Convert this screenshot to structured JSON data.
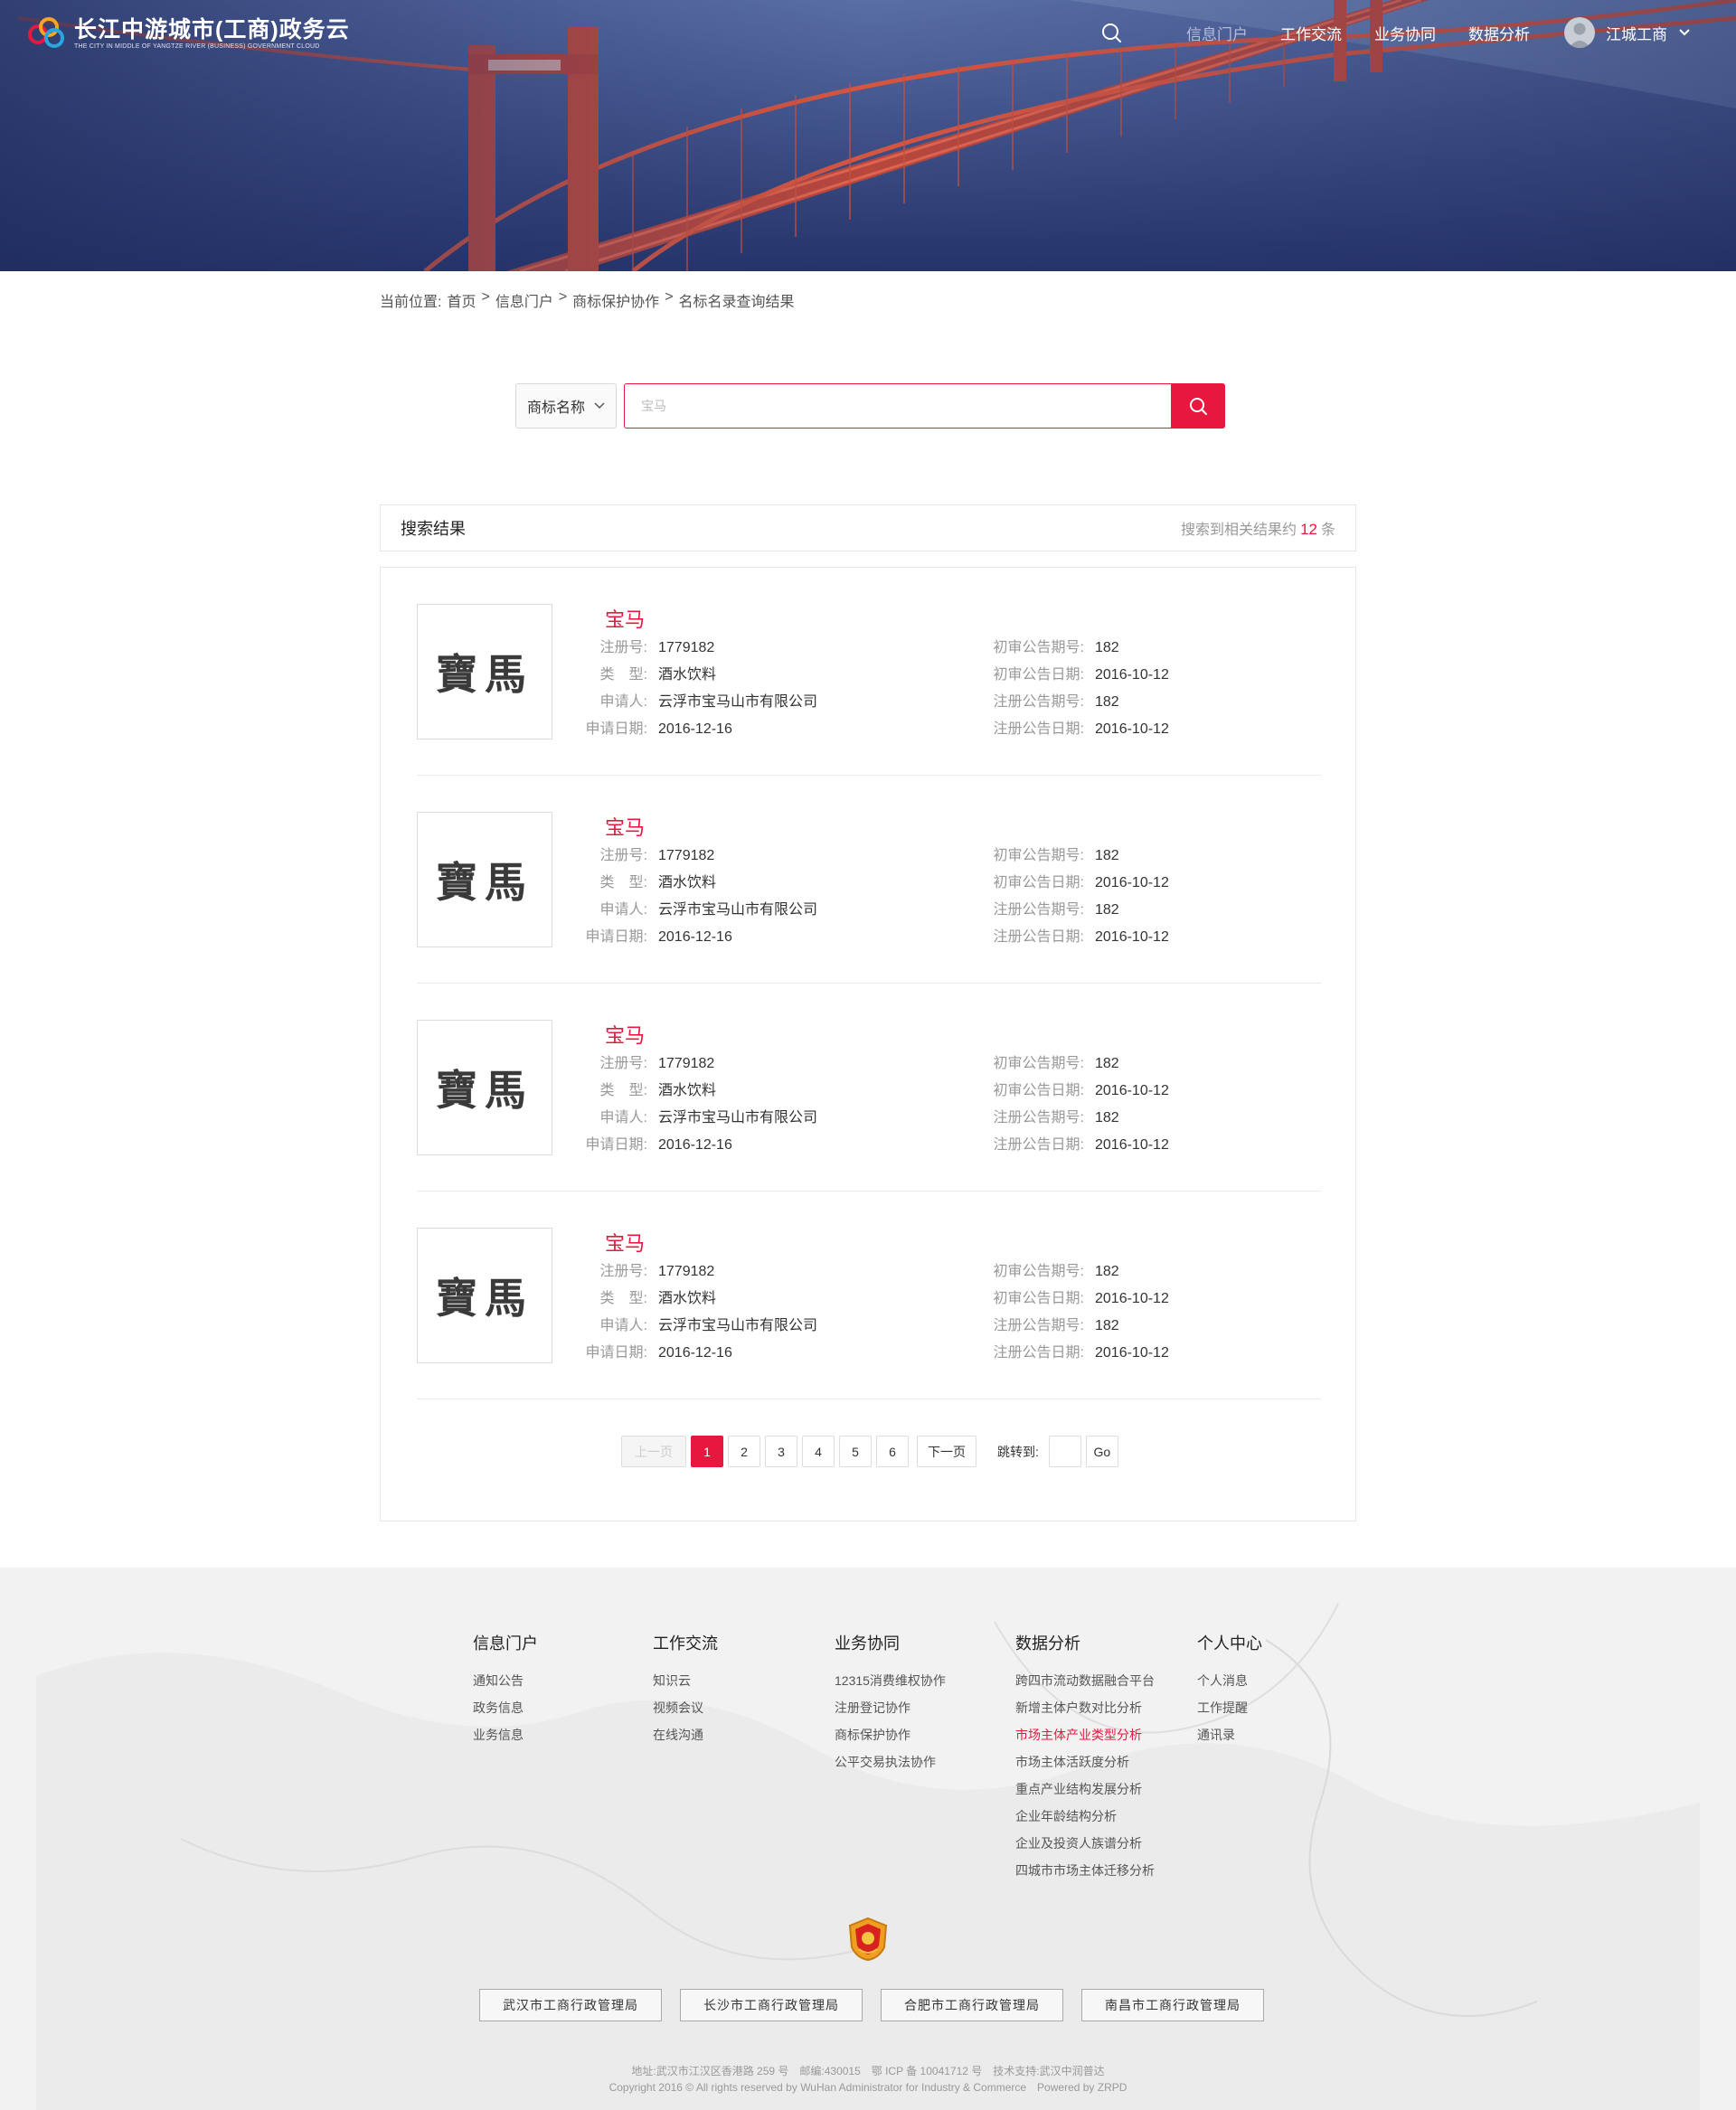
{
  "header": {
    "logo_title": "长江中游城市(工商)政务云",
    "logo_subtitle": "THE CITY IN MIDDLE OF YANGTZE RIVER (BUSINESS) GOVERNMENT CLOUD",
    "nav": [
      "信息门户",
      "工作交流",
      "业务协同",
      "数据分析"
    ],
    "active_nav": "信息门户",
    "user_name": "江城工商"
  },
  "breadcrumb": {
    "prefix": "当前位置:",
    "items": [
      "首页",
      "信息门户",
      "商标保护协作",
      "名标名录查询结果"
    ],
    "separator": ">"
  },
  "search": {
    "type_selected": "商标名称",
    "placeholder": "宝马"
  },
  "results": {
    "title": "搜索结果",
    "count_prefix": "搜索到相关结果约",
    "count": "12",
    "count_suffix": "条",
    "labels": {
      "reg_no": "注册号:",
      "type": "类　型:",
      "applicant": "申请人:",
      "apply_date": "申请日期:",
      "first_issue": "初审公告期号:",
      "first_date": "初审公告日期:",
      "reg_issue": "注册公告期号:",
      "reg_date": "注册公告日期:"
    },
    "items": [
      {
        "logo_text": "寶馬",
        "name": "宝马",
        "reg_no": "1779182",
        "type": "酒水饮料",
        "applicant": "云浮市宝马山市有限公司",
        "apply_date": "2016-12-16",
        "first_issue": "182",
        "first_date": "2016-10-12",
        "reg_issue": "182",
        "reg_date": "2016-10-12"
      },
      {
        "logo_text": "寶馬",
        "name": "宝马",
        "reg_no": "1779182",
        "type": "酒水饮料",
        "applicant": "云浮市宝马山市有限公司",
        "apply_date": "2016-12-16",
        "first_issue": "182",
        "first_date": "2016-10-12",
        "reg_issue": "182",
        "reg_date": "2016-10-12"
      },
      {
        "logo_text": "寶馬",
        "name": "宝马",
        "reg_no": "1779182",
        "type": "酒水饮料",
        "applicant": "云浮市宝马山市有限公司",
        "apply_date": "2016-12-16",
        "first_issue": "182",
        "first_date": "2016-10-12",
        "reg_issue": "182",
        "reg_date": "2016-10-12"
      },
      {
        "logo_text": "寶馬",
        "name": "宝马",
        "reg_no": "1779182",
        "type": "酒水饮料",
        "applicant": "云浮市宝马山市有限公司",
        "apply_date": "2016-12-16",
        "first_issue": "182",
        "first_date": "2016-10-12",
        "reg_issue": "182",
        "reg_date": "2016-10-12"
      }
    ]
  },
  "pagination": {
    "prev": "上一页",
    "pages": [
      "1",
      "2",
      "3",
      "4",
      "5",
      "6"
    ],
    "current": "1",
    "next": "下一页",
    "jump_label": "跳转到:",
    "go": "Go"
  },
  "footer": {
    "columns": [
      {
        "title": "信息门户",
        "links": [
          "通知公告",
          "政务信息",
          "业务信息"
        ]
      },
      {
        "title": "工作交流",
        "links": [
          "知识云",
          "视频会议",
          "在线沟通"
        ]
      },
      {
        "title": "业务协同",
        "links": [
          "12315消费维权协作",
          "注册登记协作",
          "商标保护协作",
          "公平交易执法协作"
        ]
      },
      {
        "title": "数据分析",
        "links": [
          "跨四市流动数据融合平台",
          "新增主体户数对比分析",
          "市场主体产业类型分析",
          "市场主体活跃度分析",
          "重点产业结构发展分析",
          "企业年龄结构分析",
          "企业及投资人族谱分析",
          "四城市市场主体迁移分析"
        ]
      },
      {
        "title": "个人中心",
        "links": [
          "个人消息",
          "工作提醒",
          "通讯录"
        ]
      }
    ],
    "highlight_link": "市场主体产业类型分析",
    "partner_links": [
      "武汉市工商行政管理局",
      "长沙市工商行政管理局",
      "合肥市工商行政管理局",
      "南昌市工商行政管理局"
    ],
    "address_line": "地址:武汉市江汉区香港路 259 号　邮编:430015　鄂 ICP 备 10041712 号　技术支持:武汉中润普达",
    "copyright_line": "Copyright 2016 © All rights reserved by WuHan Administrator for Industry & Commerce　Powered by ZRPD"
  },
  "colors": {
    "accent": "#e8173f",
    "hero_bg": "#2d3c74",
    "bridge": "#d04a3a"
  },
  "icons": {
    "search": "search-icon",
    "chevron": "chevron-down-icon",
    "avatar": "user-avatar-icon",
    "emblem": "national-emblem-icon"
  }
}
